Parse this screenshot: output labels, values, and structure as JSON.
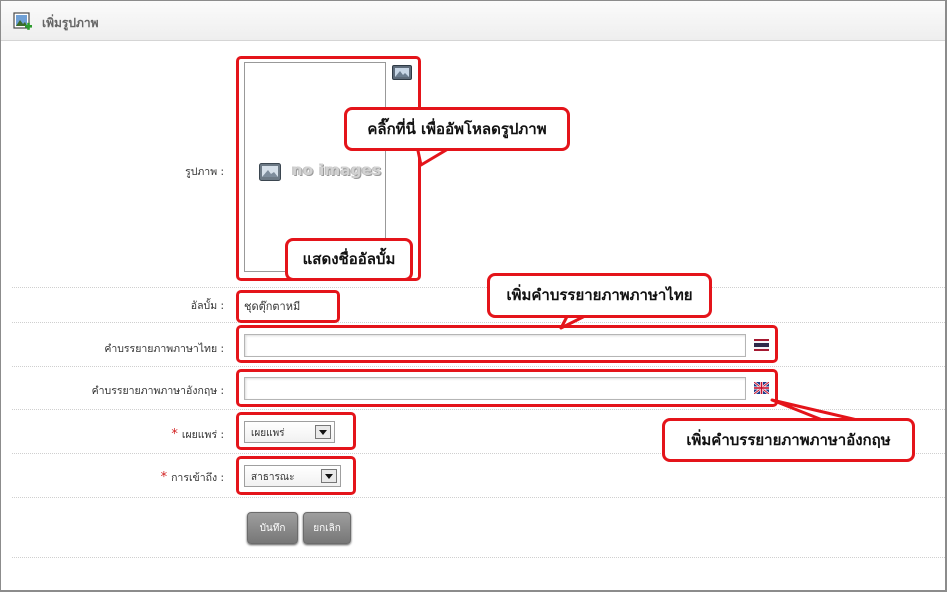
{
  "window": {
    "title": "เพิ่มรูปภาพ",
    "title_icon": "add-image-icon"
  },
  "form": {
    "image_label": "รูปภาพ :",
    "no_images_text": "no images",
    "album_label": "อัลบั้ม :",
    "album_value": "ชุดตุ๊กตาหมี",
    "desc_th_label": "คำบรรยายภาพภาษาไทย :",
    "desc_th_value": "",
    "desc_en_label": "คำบรรยายภาพภาษาอังกฤษ :",
    "desc_en_value": "",
    "publish_label": "เผยแพร่ :",
    "publish_selected": "เผยแพร่",
    "access_label": "การเข้าถึง :",
    "access_selected": "สาธารณะ",
    "required_mark": "*"
  },
  "buttons": {
    "save": "บันทึก",
    "cancel": "ยกเลิก"
  },
  "callouts": {
    "upload": "คลิ๊กที่นี่ เพื่ออัพโหลดรูปภาพ",
    "album": "แสดงชื่ออัลบั้ม",
    "desc_th": "เพิ่มคำบรรยายภาพภาษาไทย",
    "desc_en": "เพิ่มคำบรรยายภาพภาษาอังกฤษ"
  },
  "colors": {
    "annotation_red": "#e4141a",
    "required_red": "#d21f1f",
    "button_gray": "#8a8a8a"
  }
}
